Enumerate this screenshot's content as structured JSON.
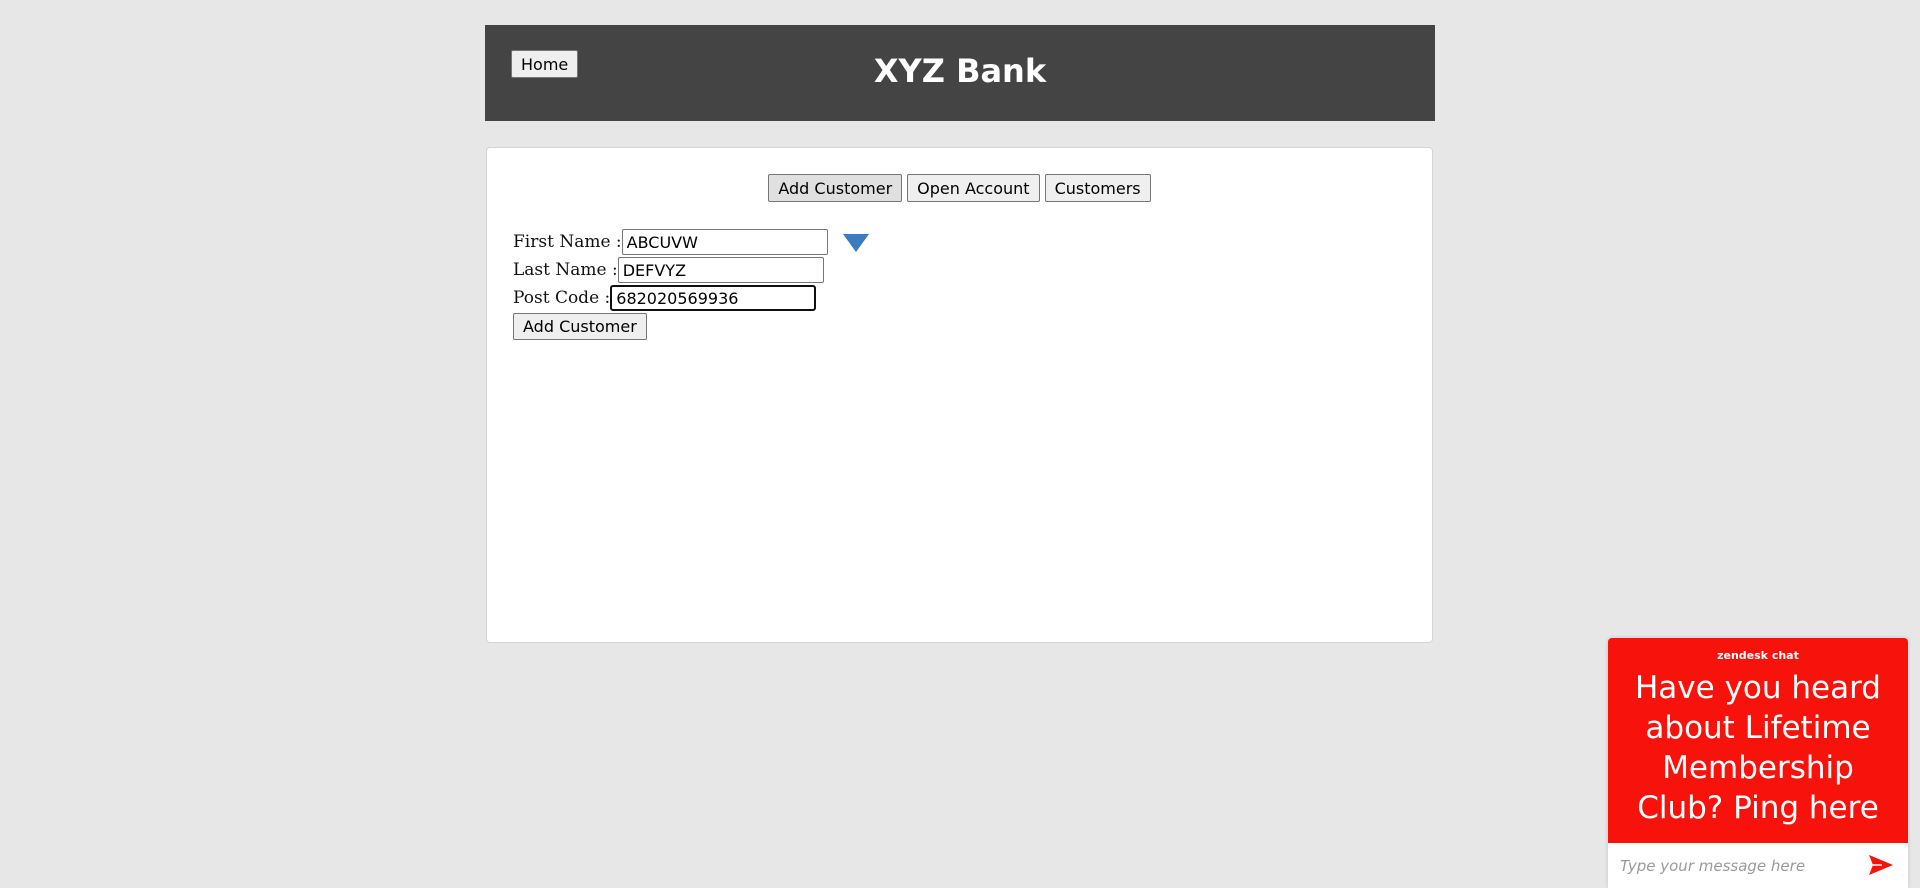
{
  "header": {
    "home_label": "Home",
    "bank_name": "XYZ Bank"
  },
  "tabs": {
    "add_customer": "Add Customer",
    "open_account": "Open Account",
    "customers": "Customers"
  },
  "form": {
    "first_name_label": "First Name :",
    "first_name_value": "ABCUVW",
    "last_name_label": "Last Name :",
    "last_name_value": "DEFVYZ",
    "post_code_label": "Post Code :",
    "post_code_value": "682020569936",
    "submit_label": "Add Customer",
    "hint_icon": "triangle-down-icon",
    "hint_color": "#3b7bbf"
  },
  "chat": {
    "brand": "zendesk chat",
    "promo": "Have you heard about Lifetime Membership Club? Ping here",
    "input_placeholder": "Type your message here",
    "send_icon": "send-arrow-icon",
    "accent_color": "#f7130c"
  },
  "colors": {
    "page_bg": "#e7e7e7",
    "header_bg": "#444444",
    "panel_bg": "#ffffff"
  }
}
